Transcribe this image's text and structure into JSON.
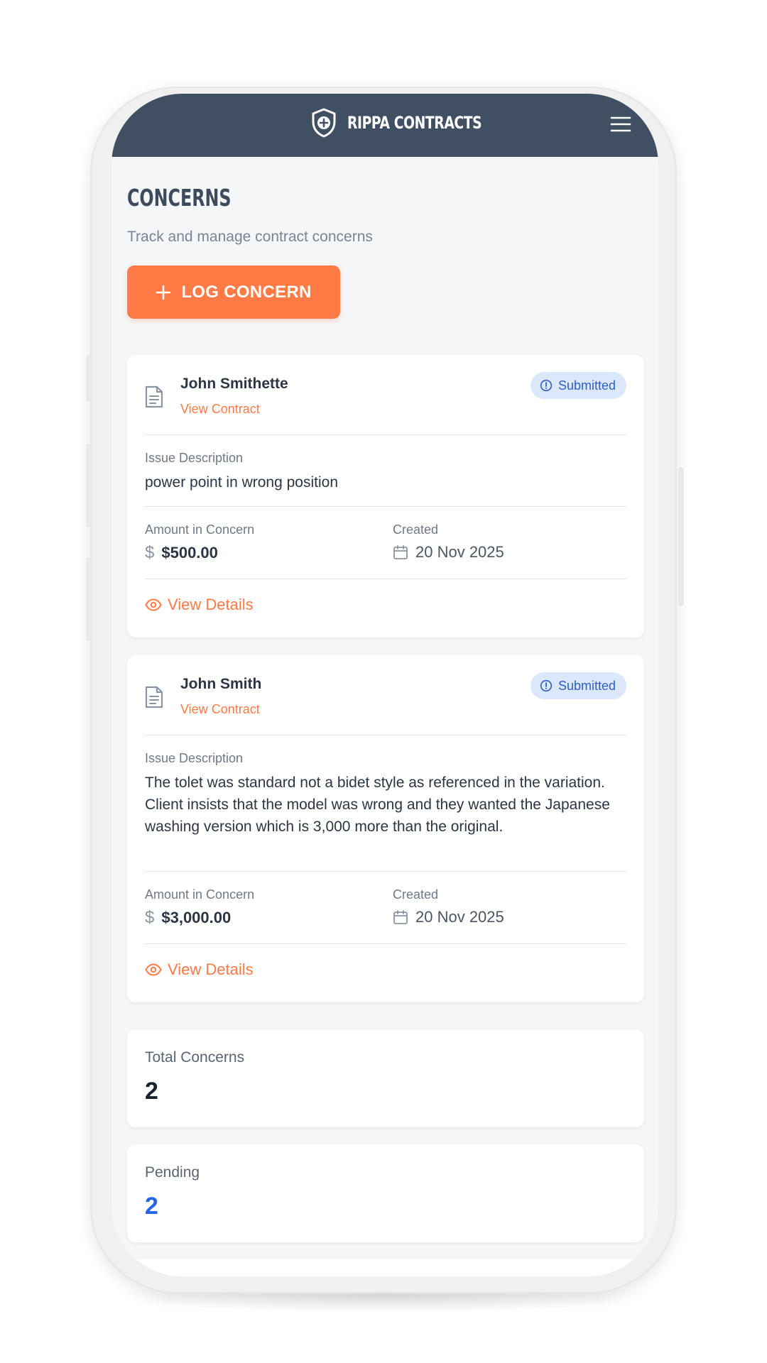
{
  "app": {
    "brand_name": "RIPPA CONTRACTS",
    "brand_icon": "shield-plus-icon",
    "menu_icon": "hamburger-menu-icon"
  },
  "page": {
    "title": "CONCERNS",
    "subtitle": "Track and manage contract concerns",
    "log_button_label": "LOG CONCERN"
  },
  "labels": {
    "view_contract": "View Contract",
    "issue_description": "Issue Description",
    "amount_in_concern": "Amount in Concern",
    "created": "Created",
    "view_details": "View Details"
  },
  "concerns": [
    {
      "client": "John Smithette",
      "status": "Submitted",
      "description": "power point in wrong position",
      "amount": "$500.00",
      "created": "20 Nov 2025"
    },
    {
      "client": "John Smith",
      "status": "Submitted",
      "description": "The tolet was standard not a bidet style as referenced in the variation. Client insists that the model was wrong and they wanted the Japanese washing version which is 3,000 more than the original.",
      "amount": "$3,000.00",
      "created": "20 Nov 2025"
    }
  ],
  "stats": {
    "total_label": "Total Concerns",
    "total_value": "2",
    "pending_label": "Pending",
    "pending_value": "2"
  },
  "colors": {
    "header_bg": "#404f61",
    "accent": "#ff7a45",
    "badge_bg": "#dbe8fb",
    "badge_text": "#2f5fc4",
    "pending_value": "#2563eb",
    "total_value": "#1a202c"
  }
}
